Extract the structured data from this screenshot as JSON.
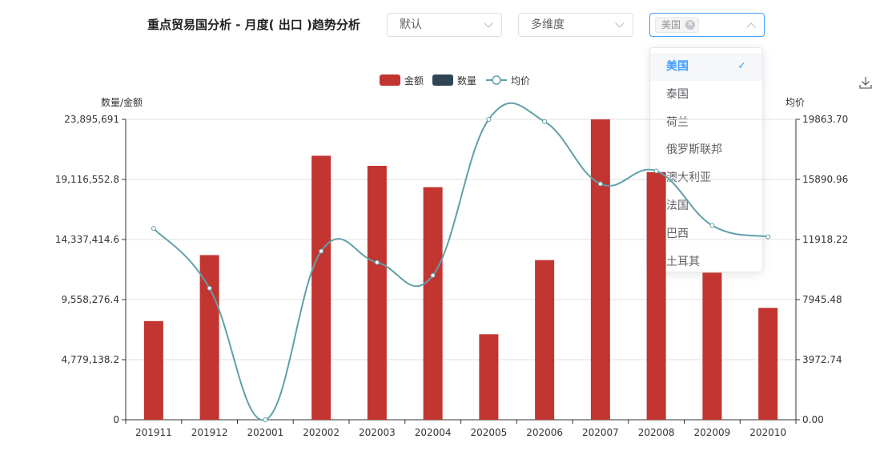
{
  "header": {
    "title": "重点贸易国分析 - 月度( 出口 )趋势分析",
    "select_default": "默认",
    "select_dimension": "多维度",
    "country_tag": "美国"
  },
  "dropdown": {
    "options": [
      "美国",
      "泰国",
      "荷兰",
      "俄罗斯联邦",
      "澳大利亚",
      "法国",
      "巴西",
      "土耳其"
    ],
    "selected": "美国"
  },
  "icons": {
    "download": "download-icon",
    "check": "check-icon",
    "close": "close-icon",
    "chevron": "chevron-icon"
  },
  "colors": {
    "amount": "#c23531",
    "quantity": "#2f4554",
    "avg": "#61a0a8",
    "accent": "#409eff"
  },
  "chart_data": {
    "type": "bar",
    "categories": [
      "201911",
      "201912",
      "202001",
      "202002",
      "202003",
      "202004",
      "202005",
      "202006",
      "202007",
      "202008",
      "202009",
      "202010"
    ],
    "legend": [
      "金额",
      "数量",
      "均价"
    ],
    "legend_position": "top-center",
    "left_axis": {
      "label": "数量/金额",
      "min": 0,
      "max": 23895691,
      "ticks": [
        "0",
        "4,779,138.2",
        "9,558,276.4",
        "14,337,414.6",
        "19,116,552.8",
        "23,895,691"
      ]
    },
    "right_axis": {
      "label": "均价",
      "min": 0,
      "max": 19863.7,
      "ticks": [
        "0.00",
        "3972.74",
        "7945.48",
        "11918.22",
        "15890.96",
        "19863.70"
      ]
    },
    "grid": true,
    "series": [
      {
        "name": "金额",
        "type": "bar",
        "axis": "left",
        "values": [
          7850000,
          13100000,
          0,
          21000000,
          20200000,
          18500000,
          6800000,
          12700000,
          23895691,
          19700000,
          11700000,
          8900000
        ]
      },
      {
        "name": "数量",
        "type": "bar",
        "axis": "left",
        "values": [
          0,
          0,
          0,
          0,
          0,
          0,
          0,
          0,
          0,
          0,
          0,
          0
        ]
      },
      {
        "name": "均价",
        "type": "line",
        "axis": "right",
        "smooth": true,
        "values": [
          12650,
          8700,
          0,
          11150,
          10400,
          9550,
          19863.7,
          19720,
          15600,
          16450,
          12850,
          12100
        ]
      }
    ]
  }
}
